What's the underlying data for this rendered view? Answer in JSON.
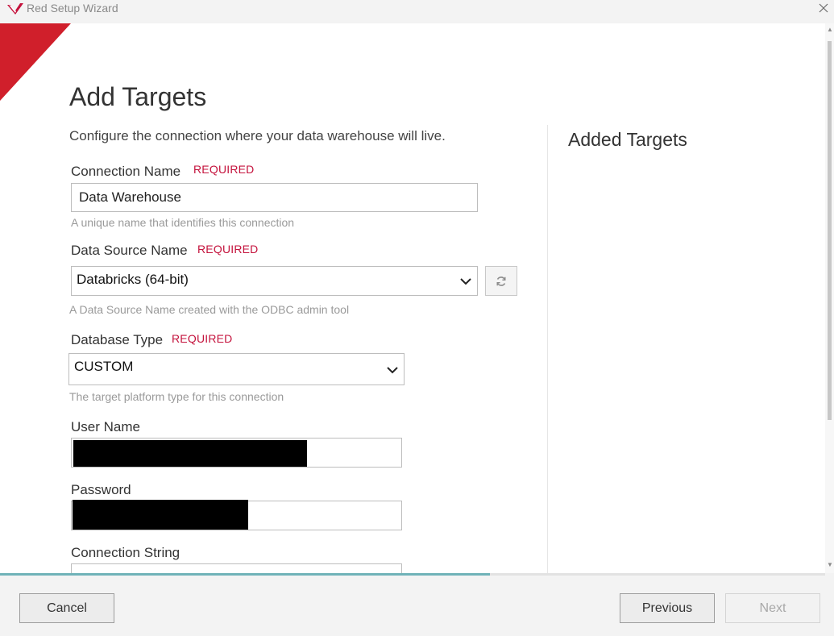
{
  "window": {
    "title": "Red Setup Wizard",
    "accent_color": "#c4123c",
    "icons": {
      "app": "red-logo-icon",
      "close": "close-icon"
    }
  },
  "page": {
    "title": "Add Targets",
    "intro": "Configure the connection where your data warehouse will live."
  },
  "form": {
    "connection_name": {
      "label": "Connection Name",
      "required": "REQUIRED",
      "value": "Data Warehouse",
      "hint": "A unique name that identifies this connection"
    },
    "data_source_name": {
      "label": "Data Source Name",
      "required": "REQUIRED",
      "value": "Databricks (64-bit)",
      "hint": "A Data Source Name created with the ODBC admin tool",
      "refresh_icon": "refresh-icon"
    },
    "database_type": {
      "label": "Database Type",
      "required": "REQUIRED",
      "value": "CUSTOM",
      "hint": "The target platform type for this connection"
    },
    "user_name": {
      "label": "User Name"
    },
    "password": {
      "label": "Password"
    },
    "connection_string": {
      "label": "Connection String"
    }
  },
  "side": {
    "title": "Added Targets"
  },
  "progress": {
    "fraction": 0.594
  },
  "footer": {
    "cancel": "Cancel",
    "previous": "Previous",
    "next": "Next"
  }
}
